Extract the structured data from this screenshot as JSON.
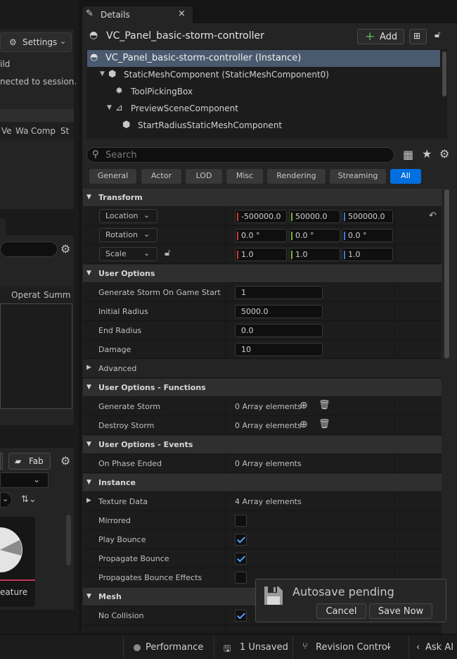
{
  "left": {
    "settings_label": "Settings",
    "text1": "ild",
    "text2": "nected to session.",
    "cols": [
      "Ve",
      "Wa",
      "Comp",
      "St"
    ],
    "cols2": [
      "Operat",
      "Summ"
    ],
    "fab_label": "Fab",
    "feature_label": "eature"
  },
  "details": {
    "tab_title": "Details",
    "object_name": "VC_Panel_basic-storm-controller",
    "add_label": "Add",
    "tree": [
      "VC_Panel_basic-storm-controller (Instance)",
      "StaticMeshComponent (StaticMeshComponent0)",
      "ToolPickingBox",
      "PreviewSceneComponent",
      "StartRadiusStaticMeshComponent"
    ],
    "search_placeholder": "Search",
    "filters": [
      "General",
      "Actor",
      "LOD",
      "Misc",
      "Rendering",
      "Streaming",
      "All"
    ],
    "transform": {
      "header": "Transform",
      "location_label": "Location",
      "rotation_label": "Rotation",
      "scale_label": "Scale",
      "location": [
        "-500000.0",
        "50000.0",
        "500000.0"
      ],
      "rotation": [
        "0.0 °",
        "0.0 °",
        "0.0 °"
      ],
      "scale": [
        "1.0",
        "1.0",
        "1.0"
      ]
    },
    "user_options": {
      "header": "User Options",
      "rows": [
        {
          "label": "Generate Storm On Game Start",
          "value": "1"
        },
        {
          "label": "Initial Radius",
          "value": "5000.0"
        },
        {
          "label": "End Radius",
          "value": "0.0"
        },
        {
          "label": "Damage",
          "value": "10"
        }
      ],
      "advanced": "Advanced"
    },
    "functions": {
      "header": "User Options - Functions",
      "rows": [
        {
          "label": "Generate Storm",
          "value": "0 Array elements"
        },
        {
          "label": "Destroy Storm",
          "value": "0 Array elements"
        }
      ]
    },
    "events": {
      "header": "User Options - Events",
      "rows": [
        {
          "label": "On Phase Ended",
          "value": "0 Array elements"
        }
      ]
    },
    "instance": {
      "header": "Instance",
      "texture_label": "Texture Data",
      "texture_value": "4 Array elements",
      "mirrored": "Mirrored",
      "play_bounce": "Play Bounce",
      "propagate_bounce": "Propagate Bounce",
      "propagates_effects": "Propagates Bounce Effects"
    },
    "mesh": {
      "header": "Mesh",
      "no_collision": "No Collision"
    }
  },
  "toast": {
    "title": "Autosave pending",
    "cancel": "Cancel",
    "save_now": "Save Now"
  },
  "statusbar": {
    "performance": "Performance",
    "unsaved": "1 Unsaved",
    "revision": "Revision Control",
    "ask_ai": "Ask AI"
  },
  "colors": {
    "accent": "#0070e0",
    "check": "#4ea3ff",
    "bg": "#242424"
  }
}
